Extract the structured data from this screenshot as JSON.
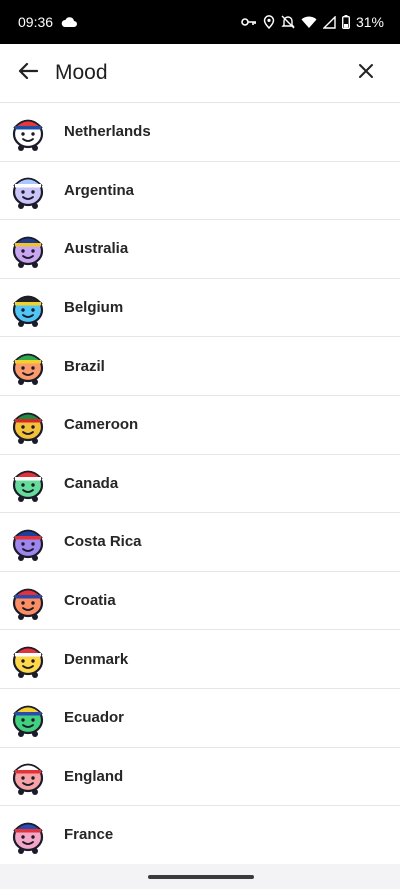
{
  "status": {
    "time": "09:36",
    "battery": "31%"
  },
  "header": {
    "title": "Mood"
  },
  "colors": {
    "accent": "#33ccff",
    "text": "#262626",
    "divider": "#e6e6e6"
  },
  "moods": [
    {
      "label": "Netherlands",
      "body": "#ffffff",
      "hat": "#e23a3a",
      "band": "#1e4fa8",
      "icon": "netherlands-mood-icon"
    },
    {
      "label": "Argentina",
      "body": "#c9c6f7",
      "hat": "#a9c8ff",
      "band": "#ffffff",
      "icon": "argentina-mood-icon"
    },
    {
      "label": "Australia",
      "body": "#c9a6f2",
      "hat": "#1e3c8c",
      "band": "#f2c12e",
      "icon": "australia-mood-icon"
    },
    {
      "label": "Belgium",
      "body": "#4fc6f5",
      "hat": "#222222",
      "band": "#f2d02e",
      "icon": "belgium-mood-icon"
    },
    {
      "label": "Brazil",
      "body": "#fb9a6b",
      "hat": "#2ea84a",
      "band": "#f2d02e",
      "icon": "brazil-mood-icon"
    },
    {
      "label": "Cameroon",
      "body": "#f4c23a",
      "hat": "#1f8a3b",
      "band": "#d8262a",
      "icon": "cameroon-mood-icon"
    },
    {
      "label": "Canada",
      "body": "#66dc9b",
      "hat": "#e2333a",
      "band": "#ffffff",
      "icon": "canada-mood-icon"
    },
    {
      "label": "Costa Rica",
      "body": "#9f86ee",
      "hat": "#1f3f9c",
      "band": "#e2333a",
      "icon": "costa-rica-mood-icon"
    },
    {
      "label": "Croatia",
      "body": "#fb8f63",
      "hat": "#e2333a",
      "band": "#2b4ab0",
      "icon": "croatia-mood-icon"
    },
    {
      "label": "Denmark",
      "body": "#ffd84a",
      "hat": "#e2333a",
      "band": "#ffffff",
      "icon": "denmark-mood-icon"
    },
    {
      "label": "Ecuador",
      "body": "#40d07e",
      "hat": "#f2d02e",
      "band": "#2b4ab0",
      "icon": "ecuador-mood-icon"
    },
    {
      "label": "England",
      "body": "#f7a3a6",
      "hat": "#ffffff",
      "band": "#e2333a",
      "icon": "england-mood-icon"
    },
    {
      "label": "France",
      "body": "#f4a6c6",
      "hat": "#2b4ab0",
      "band": "#e2333a",
      "icon": "france-mood-icon"
    }
  ]
}
